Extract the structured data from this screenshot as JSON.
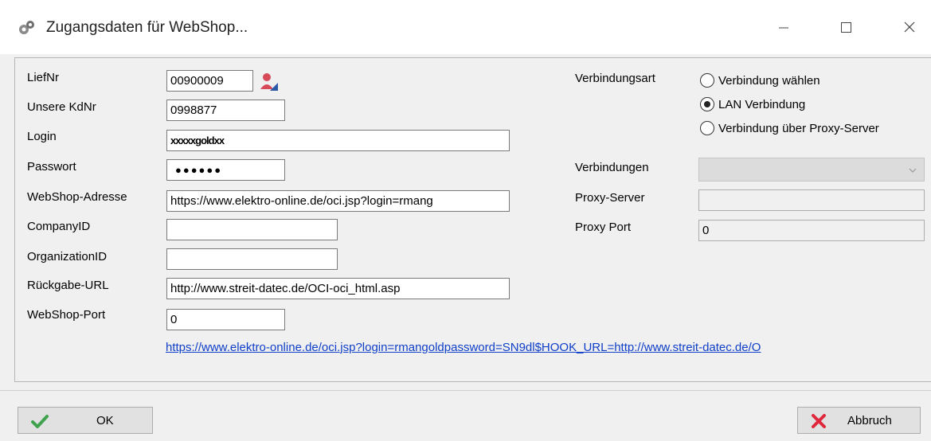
{
  "window": {
    "title": "Zugangsdaten für WebShop...",
    "icon": "gear-icon"
  },
  "form": {
    "liefnr": {
      "label": "LiefNr",
      "value": "00900009"
    },
    "kdnr": {
      "label": "Unsere KdNr",
      "value": "0998877"
    },
    "login": {
      "label": "Login",
      "value": "xxxxxgoldxx"
    },
    "passwort": {
      "label": "Passwort",
      "value": "●●●●●●"
    },
    "webshop_adresse": {
      "label": "WebShop-Adresse",
      "value": "https://www.elektro-online.de/oci.jsp?login=rmang"
    },
    "company_id": {
      "label": "CompanyID",
      "value": ""
    },
    "organization_id": {
      "label": "OrganizationID",
      "value": ""
    },
    "rueckgabe_url": {
      "label": "Rückgabe-URL",
      "value": "http://www.streit-datec.de/OCI-oci_html.asp"
    },
    "webshop_port": {
      "label": "WebShop-Port",
      "value": "0"
    },
    "full_link": "https://www.elektro-online.de/oci.jsp?login=rmangoldpassword=SN9dl$HOOK_URL=http://www.streit-datec.de/O"
  },
  "connection": {
    "label": "Verbindungsart",
    "options": [
      {
        "label": "Verbindung wählen",
        "selected": false
      },
      {
        "label": "LAN Verbindung",
        "selected": true
      },
      {
        "label": "Verbindung über Proxy-Server",
        "selected": false
      }
    ],
    "verbindungen_label": "Verbindungen",
    "verbindungen_value": "",
    "proxy_server_label": "Proxy-Server",
    "proxy_server_value": "",
    "proxy_port_label": "Proxy Port",
    "proxy_port_value": "0"
  },
  "buttons": {
    "ok": "OK",
    "cancel": "Abbruch"
  },
  "colors": {
    "link": "#0f3fc8",
    "ok_check": "#3fa34d",
    "cancel_x": "#e0283c"
  }
}
